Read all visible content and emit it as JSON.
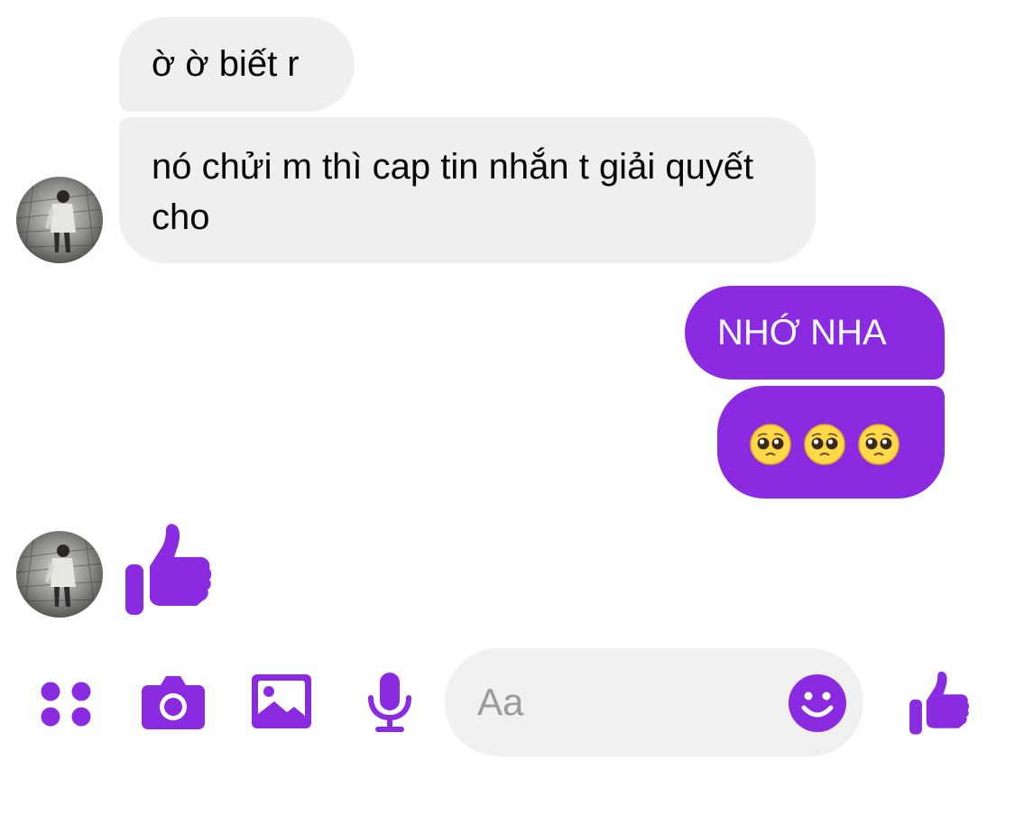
{
  "conversation": {
    "messages": [
      {
        "sender": "contact",
        "text": "ờ ờ biết r"
      },
      {
        "sender": "contact",
        "text": "nó chửi m thì cap tin nhắn t giải quyết cho"
      },
      {
        "sender": "self",
        "text": "NHỚ NHA"
      },
      {
        "sender": "self",
        "emoji": [
          "pleading-face",
          "pleading-face",
          "pleading-face"
        ]
      },
      {
        "sender": "contact",
        "sticker": "thumbs-up-icon"
      }
    ]
  },
  "composer": {
    "placeholder": "Aa",
    "value": "",
    "tools": [
      "menu-icon",
      "camera-icon",
      "photo-icon",
      "microphone-icon"
    ],
    "emoji_button_icon": "smiley-icon",
    "send_button_icon": "thumbs-up-icon"
  },
  "colors": {
    "accent": "#8a2be2",
    "incoming_bubble": "#efefef",
    "composer_background": "#f0f0f0"
  }
}
